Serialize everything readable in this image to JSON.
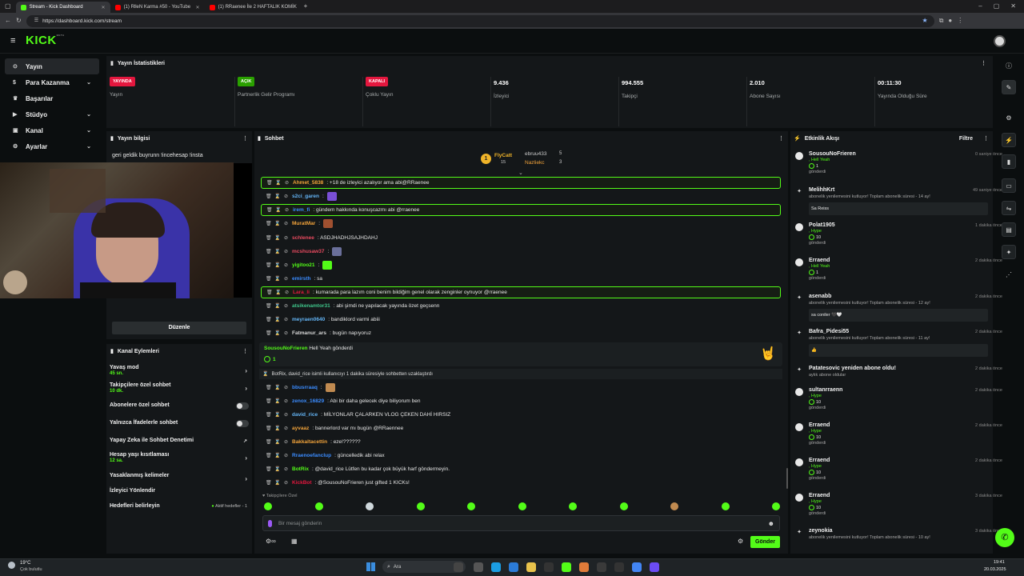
{
  "browser": {
    "tabs": [
      {
        "title": "Stream - Kick Dashboard",
        "active": true,
        "color": "#53fc18"
      },
      {
        "title": "(1) RlleN Karma #50 - YouTube",
        "active": false,
        "color": "#ff0000"
      },
      {
        "title": "(1) RRaenee İle 2 HAFTALIK KOMİK",
        "active": false,
        "color": "#ff0000"
      }
    ],
    "new_tab": "+",
    "url": "https://dashboard.kick.com/stream"
  },
  "kick": {
    "logo": "KICK",
    "logo_sup": "BETA"
  },
  "nav": {
    "items": [
      {
        "label": "Yayın",
        "icon": "stream-icon",
        "chev": ""
      },
      {
        "label": "Para Kazanma",
        "icon": "money-icon",
        "chev": "⌄"
      },
      {
        "label": "Başarılar",
        "icon": "trophy-icon",
        "chev": ""
      },
      {
        "label": "Stüdyo",
        "icon": "studio-icon",
        "chev": "⌄"
      },
      {
        "label": "Kanal",
        "icon": "channel-icon",
        "chev": "⌄"
      },
      {
        "label": "Ayarlar",
        "icon": "gear-icon",
        "chev": "⌄"
      }
    ]
  },
  "stats": {
    "title": "Yayın İstatistikleri",
    "cards": [
      {
        "badge": "YAYINDA",
        "badge_color": "#e3173e",
        "value": "",
        "label": "Yayın"
      },
      {
        "badge": "AÇIK",
        "badge_color": "#2aa000",
        "value": "",
        "label": "Partnerlik Gelir Programı"
      },
      {
        "badge": "KAPALI",
        "badge_color": "#e3173e",
        "value": "",
        "label": "Çoklu Yayın"
      },
      {
        "badge": "",
        "badge_color": "",
        "value": "9.436",
        "label": "İzleyici"
      },
      {
        "badge": "",
        "badge_color": "",
        "value": "994.555",
        "label": "Takipçi"
      },
      {
        "badge": "",
        "badge_color": "",
        "value": "2.010",
        "label": "Abone Sayısı"
      },
      {
        "badge": "",
        "badge_color": "",
        "value": "00:11:30",
        "label": "Yayında Olduğu Süre"
      }
    ]
  },
  "stream_info": {
    "title": "Yayın bilgisi",
    "stream_title": "geri geldik buyrunn !incehesap !insta",
    "edit_button": "Düzenle"
  },
  "channel_actions": {
    "title": "Kanal Eylemleri",
    "items": [
      {
        "label": "Yavaş mod",
        "sub": "45 sn.",
        "control": "chev"
      },
      {
        "label": "Takipçilere özel sohbet",
        "sub": "10 dk.",
        "control": "chev"
      },
      {
        "label": "Abonelere özel sohbet",
        "sub": "",
        "control": "toggle"
      },
      {
        "label": "Yalnızca İfadelerle sohbet",
        "sub": "",
        "control": "toggle"
      },
      {
        "label": "Yapay Zeka ile Sohbet Denetimi",
        "sub": "",
        "control": "ext"
      },
      {
        "label": "Hesap yaşı kısıtlaması",
        "sub": "12 sa.",
        "control": "chev"
      },
      {
        "label": "Yasaklanmış kelimeler",
        "sub": "",
        "control": "chev"
      },
      {
        "label": "İzleyici Yönlendir",
        "sub": "",
        "control": ""
      },
      {
        "label": "Hedefleri belirleyin",
        "sub": "",
        "control": "goal",
        "extra": "Aktif hedefler - 1"
      }
    ]
  },
  "chat": {
    "title": "Sohbet",
    "top_gifters": [
      {
        "name": "FlyCatt",
        "count": "15"
      },
      {
        "name": "ebruu433",
        "count": "5"
      },
      {
        "name": "Nazliekc",
        "count": "3"
      }
    ],
    "messages": [
      {
        "user": "Ahmet_5838",
        "color": "#f2a33a",
        "text": ": +18 de izleyici azalıyor ama abi@RRaenee",
        "hl": true,
        "emote": ""
      },
      {
        "user": "s2ci_garen",
        "color": "#64b5f6",
        "text": ":",
        "hl": false,
        "emote": "#7a4fd6"
      },
      {
        "user": "irem_fi",
        "color": "#3b8cff",
        "text": ": gündem hakkında konuşcazmı abi @rraenee",
        "hl": true,
        "emote": ""
      },
      {
        "user": "MuratMar",
        "color": "#f2a33a",
        "text": ":",
        "hl": false,
        "emote": "#a05030"
      },
      {
        "user": "schlenee",
        "color": "#e84a5f",
        "text": ": ASDJHADHJSAJHDAHJ",
        "hl": false,
        "emote": ""
      },
      {
        "user": "mcshusaw37",
        "color": "#e84a5f",
        "text": ":",
        "hl": false,
        "emote": "#6a6f9a"
      },
      {
        "user": "yigitoo21",
        "color": "#53fc18",
        "text": ":",
        "hl": false,
        "emote": "#53fc18"
      },
      {
        "user": "emirsth",
        "color": "#3b8cff",
        "text": ": sa",
        "hl": false,
        "emote": ""
      },
      {
        "user": "Lara_li",
        "color": "#e3173e",
        "text": ": kumarada para lazım coni benim bildiğim genel olarak zenginler oynuyor @rraenee",
        "hl": true,
        "emote": ""
      },
      {
        "user": "atsikenamtor31",
        "color": "#3fc58a",
        "text": ": abi şimdi ne yapılacak yayında özet geçsenn",
        "hl": false,
        "emote": ""
      },
      {
        "user": "meyraen0640",
        "color": "#64b5f6",
        "text": ": bandiklord varmi abiii",
        "hl": false,
        "emote": ""
      },
      {
        "user": "Fatmanur_ars",
        "color": "#d8d8d8",
        "text": ": bugün napıyoruz",
        "hl": false,
        "emote": ""
      }
    ],
    "gift_event": {
      "user": "SousouNoFrieren",
      "text": "Hell Yeah gönderdi",
      "count": "1"
    },
    "timeout_notice": "BotRix, david_rice isimli kullanıcıyı 1 dakika süresiyle sohbetten uzaklaştırdı",
    "messages2": [
      {
        "user": "bbusrraaq",
        "color": "#3b8cff",
        "text": ":",
        "emote": "#c08a50"
      },
      {
        "user": "zenox_16829",
        "color": "#3b8cff",
        "text": ": Abi bir daha gelecek diye biliyorum ben",
        "emote": ""
      },
      {
        "user": "david_rice",
        "color": "#64b5f6",
        "text": ": MİLYONLAR ÇALARKEN VLOG ÇEKEN DAHİ HIRSIZ",
        "emote": ""
      },
      {
        "user": "ayvaaz",
        "color": "#f2a33a",
        "text": ": bannerlord var mı bugün @RRaennee",
        "emote": ""
      },
      {
        "user": "Bakkaltacettin",
        "color": "#f2a33a",
        "text": ": eze!??????",
        "emote": ""
      },
      {
        "user": "Rraenoefanclup",
        "color": "#3b8cff",
        "text": ": güncelledik abi relax",
        "emote": ""
      },
      {
        "user": "BotRix",
        "color": "#53fc18",
        "text": ": @david_rice Lütfen bu kadar çok büyük harf göndermeyin.",
        "emote": ""
      },
      {
        "user": "KickBot",
        "color": "#e3173e",
        "text": ": @SousouNoFrieren just gifted 1 KICKs!",
        "emote": ""
      }
    ],
    "followers_only": "Takipçilere Özel",
    "input_placeholder": "Bir mesaj gönderin",
    "send_button": "Gönder"
  },
  "activity": {
    "title": "Etkinlik Akışı",
    "filter": "Filtre",
    "items": [
      {
        "name": "SousouNoFrieren",
        "time": "0 saniye önce",
        "line1": ", Hell Yeah",
        "count": "1",
        "tail": "gönderdi",
        "box": ""
      },
      {
        "name": "MelihhKrt",
        "time": "49 saniye önce",
        "line1": "",
        "count": "",
        "tail": "",
        "sub": "abonelik yenilemesini kutluyor! Toplam abonelik süresi - 14 ay!",
        "box": "Sa Reiss"
      },
      {
        "name": "Polat1905",
        "time": "1 dakika önce",
        "line1": ", Hype",
        "count": "10",
        "tail": "gönderdi",
        "box": ""
      },
      {
        "name": "Erraend",
        "time": "2 dakika önce",
        "line1": ", Hell Yeah",
        "count": "1",
        "tail": "gönderdi",
        "box": ""
      },
      {
        "name": "asenabb",
        "time": "2 dakika önce",
        "line1": "",
        "count": "",
        "tail": "",
        "sub": "abonelik yenilemesini kutluyor! Toplam abonelik süresi - 12 ay!",
        "box": "sa coniler 🖤🤍"
      },
      {
        "name": "Bafra_Pidesi55",
        "time": "2 dakika önce",
        "line1": "",
        "count": "",
        "tail": "",
        "sub": "abonelik yenilemesini kutluyor! Toplam abonelik süresi - 11 ay!",
        "box": "👍"
      },
      {
        "name": "Patatesovic yeniden abone oldu!",
        "time": "2 dakika önce",
        "line1": "",
        "count": "",
        "tail": "",
        "sub": "aylık abone oldular",
        "box": ""
      },
      {
        "name": "sultanrraenn",
        "time": "2 dakika önce",
        "line1": ", Hype",
        "count": "10",
        "tail": "gönderdi",
        "box": ""
      },
      {
        "name": "Erraend",
        "time": "2 dakika önce",
        "line1": ", Hype",
        "count": "10",
        "tail": "gönderdi",
        "box": ""
      },
      {
        "name": "Erraend",
        "time": "2 dakika önce",
        "line1": ", Hype",
        "count": "10",
        "tail": "gönderdi",
        "box": ""
      },
      {
        "name": "Erraend",
        "time": "3 dakika önce",
        "line1": ", Hype",
        "count": "10",
        "tail": "gönderdi",
        "box": ""
      },
      {
        "name": "zeynokia",
        "time": "3 dakika önce",
        "line1": "",
        "count": "",
        "tail": "",
        "sub": "abonelik yenilemesini kutluyor! Toplam abonelik süresi - 10 ay!",
        "box": ""
      }
    ]
  },
  "taskbar": {
    "weather_temp": "19°C",
    "weather_desc": "Çok bulutlu",
    "search": "Ara",
    "time": "19:41",
    "date": "20.03.2025"
  }
}
